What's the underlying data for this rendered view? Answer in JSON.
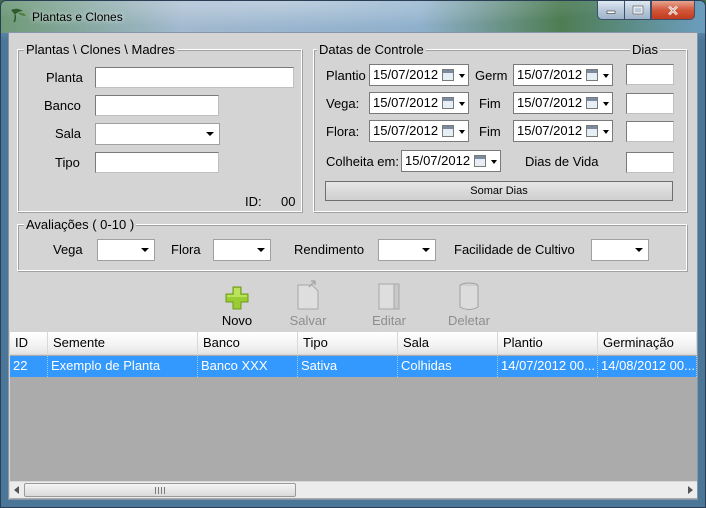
{
  "window": {
    "title": "Plantas e Clones"
  },
  "plantas_group": {
    "legend": "Plantas \\ Clones \\ Madres",
    "fields": {
      "planta": {
        "label": "Planta",
        "value": ""
      },
      "banco": {
        "label": "Banco",
        "value": ""
      },
      "sala": {
        "label": "Sala",
        "value": ""
      },
      "tipo": {
        "label": "Tipo",
        "value": ""
      }
    },
    "id_label": "ID:",
    "id_value": "00"
  },
  "datas_group": {
    "legend": "Datas de Controle",
    "dias_label": "Dias",
    "rows": {
      "plantio": {
        "label": "Plantio",
        "date": "15/07/2012",
        "end_label": "Germ",
        "end_date": "15/07/2012",
        "days": ""
      },
      "vega": {
        "label": "Vega:",
        "date": "15/07/2012",
        "end_label": "Fim",
        "end_date": "15/07/2012",
        "days": ""
      },
      "flora": {
        "label": "Flora:",
        "date": "15/07/2012",
        "end_label": "Fim",
        "end_date": "15/07/2012",
        "days": ""
      }
    },
    "colheita": {
      "label": "Colheita em:",
      "date": "15/07/2012"
    },
    "dias_vida": {
      "label": "Dias de Vida",
      "value": ""
    },
    "somar_button": "Somar Dias"
  },
  "avaliacoes_group": {
    "legend": "Avaliações ( 0-10 )",
    "fields": {
      "vega": "Vega",
      "flora": "Flora",
      "rendimento": "Rendimento",
      "facilidade": "Facilidade de Cultivo"
    }
  },
  "toolbar": {
    "novo": "Novo",
    "salvar": "Salvar",
    "editar": "Editar",
    "deletar": "Deletar"
  },
  "grid": {
    "columns": [
      "ID",
      "Semente",
      "Banco",
      "Tipo",
      "Sala",
      "Plantio",
      "Germinação"
    ],
    "rows": [
      [
        "22",
        "Exemplo de Planta",
        "Banco XXX",
        "Sativa",
        "Colhidas",
        "14/07/2012 00...",
        "14/08/2012 00..."
      ]
    ]
  },
  "colors": {
    "selection": "#3399ff",
    "form_background": "#d4d4d4",
    "grid_background": "#ababab",
    "add_icon": "#9acd32"
  }
}
